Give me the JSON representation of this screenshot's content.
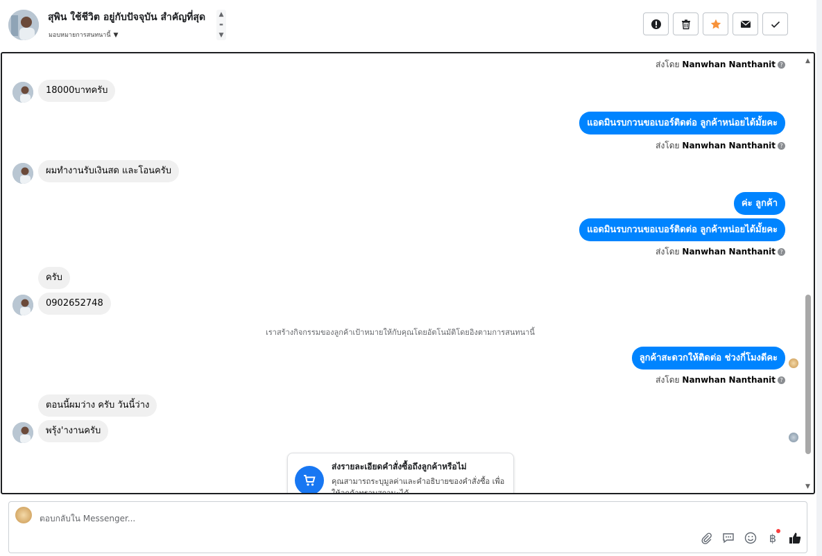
{
  "header": {
    "title": "สุพิน ใช้ชีวิต อยู่กับปัจจุบัน สำคัญที่สุด",
    "assign_label": "มอบหมายการสนทนานี้",
    "buttons": [
      {
        "name": "spam-button",
        "icon": "exclamation-icon"
      },
      {
        "name": "delete-button",
        "icon": "trash-icon"
      },
      {
        "name": "star-button",
        "icon": "star-icon",
        "color": "#f7923a"
      },
      {
        "name": "mark-unread-button",
        "icon": "envelope-icon"
      },
      {
        "name": "done-button",
        "icon": "check-icon"
      }
    ]
  },
  "sent_by_prefix": "ส่งโดย",
  "agent_name": "Nanwhan Nanthanit",
  "messages": {
    "in1": "18000บาทครับ",
    "out1": "แอดมินรบกวนขอเบอร์ติดต่อ ลูกค้าหน่อยได้มั้ยคะ",
    "in2": "ผมทำงานรับเงินสด  และโอนครับ",
    "out2": "ค่ะ ลูกค้า",
    "out3": "แอดมินรบกวนขอเบอร์ติดต่อ ลูกค้าหน่อยได้มั้ยคะ",
    "in3": "ครับ",
    "in4": "0902652748",
    "system_note": "เราสร้างกิจกรรมของลูกค้าเป้าหมายให้กับคุณโดยอัตโนมัติโดยอิงตามการสนทนานี้",
    "out4": "ลูกค้าสะดวกให้ติดต่อ ช่วงกี่โมงดีคะ",
    "in5": "ตอนนี้ผมว่าง  ครับ  วันนี้ว่าง",
    "in6": "พรุ้ง'างานครับ"
  },
  "order_card": {
    "title": "ส่งรายละเอียดคำสั่งซื้อถึงลูกค้าหรือไม่",
    "description": "คุณสามารถระบุมูลค่าและคำอธิบายของคำสั่งซื้อ เพื่อให้ลูกค้าทราบสถานะได้"
  },
  "composer": {
    "placeholder": "ตอบกลับใน Messenger...",
    "tools": [
      "paperclip-icon",
      "saved-reply-icon",
      "emoji-icon",
      "baht-icon",
      "thumbs-up-icon"
    ]
  },
  "colors": {
    "outgoing_bubble": "#0084ff",
    "incoming_bubble": "#f0f0f0",
    "accent_star": "#f7923a"
  }
}
